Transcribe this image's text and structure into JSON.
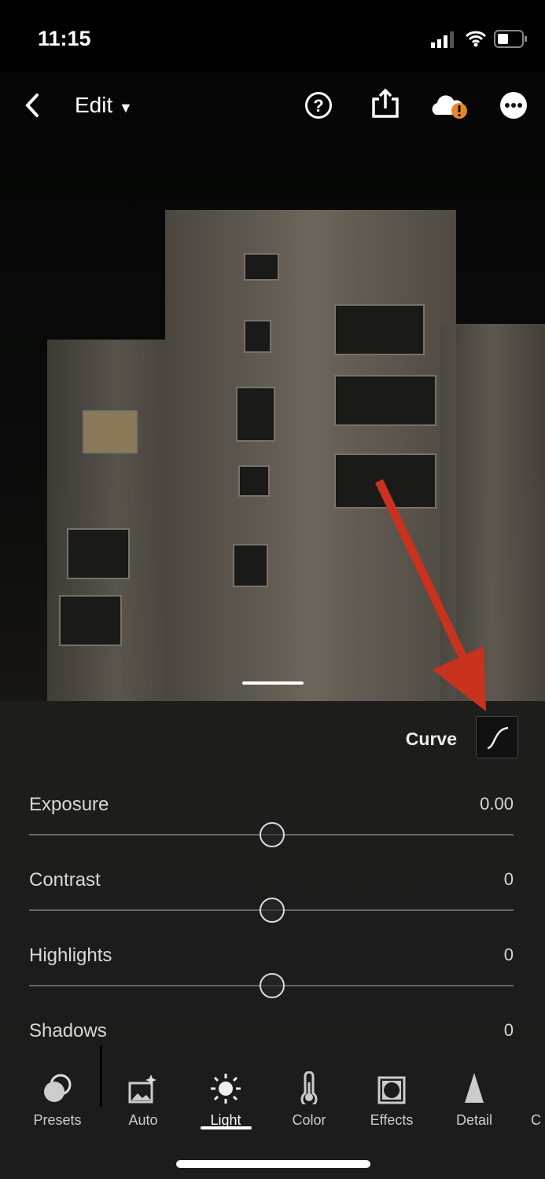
{
  "status_bar": {
    "time": "11:15",
    "signal_icon": "cellular-signal-icon",
    "wifi_icon": "wifi-icon",
    "battery_icon": "battery-icon"
  },
  "header": {
    "back_icon": "chevron-left-icon",
    "title": "Edit",
    "dropdown_icon": "caret-down-icon",
    "actions": [
      "help-icon",
      "share-icon",
      "cloud-warning-icon",
      "more-icon"
    ],
    "warning_color": "#e8872a"
  },
  "panel": {
    "curve_label": "Curve",
    "curve_icon": "tone-curve-icon",
    "sliders": [
      {
        "label": "Exposure",
        "value": "0.00",
        "position": 0.5
      },
      {
        "label": "Contrast",
        "value": "0",
        "position": 0.5
      },
      {
        "label": "Highlights",
        "value": "0",
        "position": 0.5
      },
      {
        "label": "Shadows",
        "value": "0",
        "position": 0.5
      }
    ]
  },
  "annotation": {
    "arrow_color": "#c8321e"
  },
  "toolbar": {
    "items": [
      {
        "label": "Presets",
        "icon": "presets-icon"
      },
      {
        "label": "Auto",
        "icon": "auto-icon"
      },
      {
        "label": "Light",
        "icon": "sun-icon",
        "active": true
      },
      {
        "label": "Color",
        "icon": "thermometer-icon"
      },
      {
        "label": "Effects",
        "icon": "vignette-icon"
      },
      {
        "label": "Detail",
        "icon": "triangle-icon"
      },
      {
        "label": "C"
      }
    ]
  }
}
